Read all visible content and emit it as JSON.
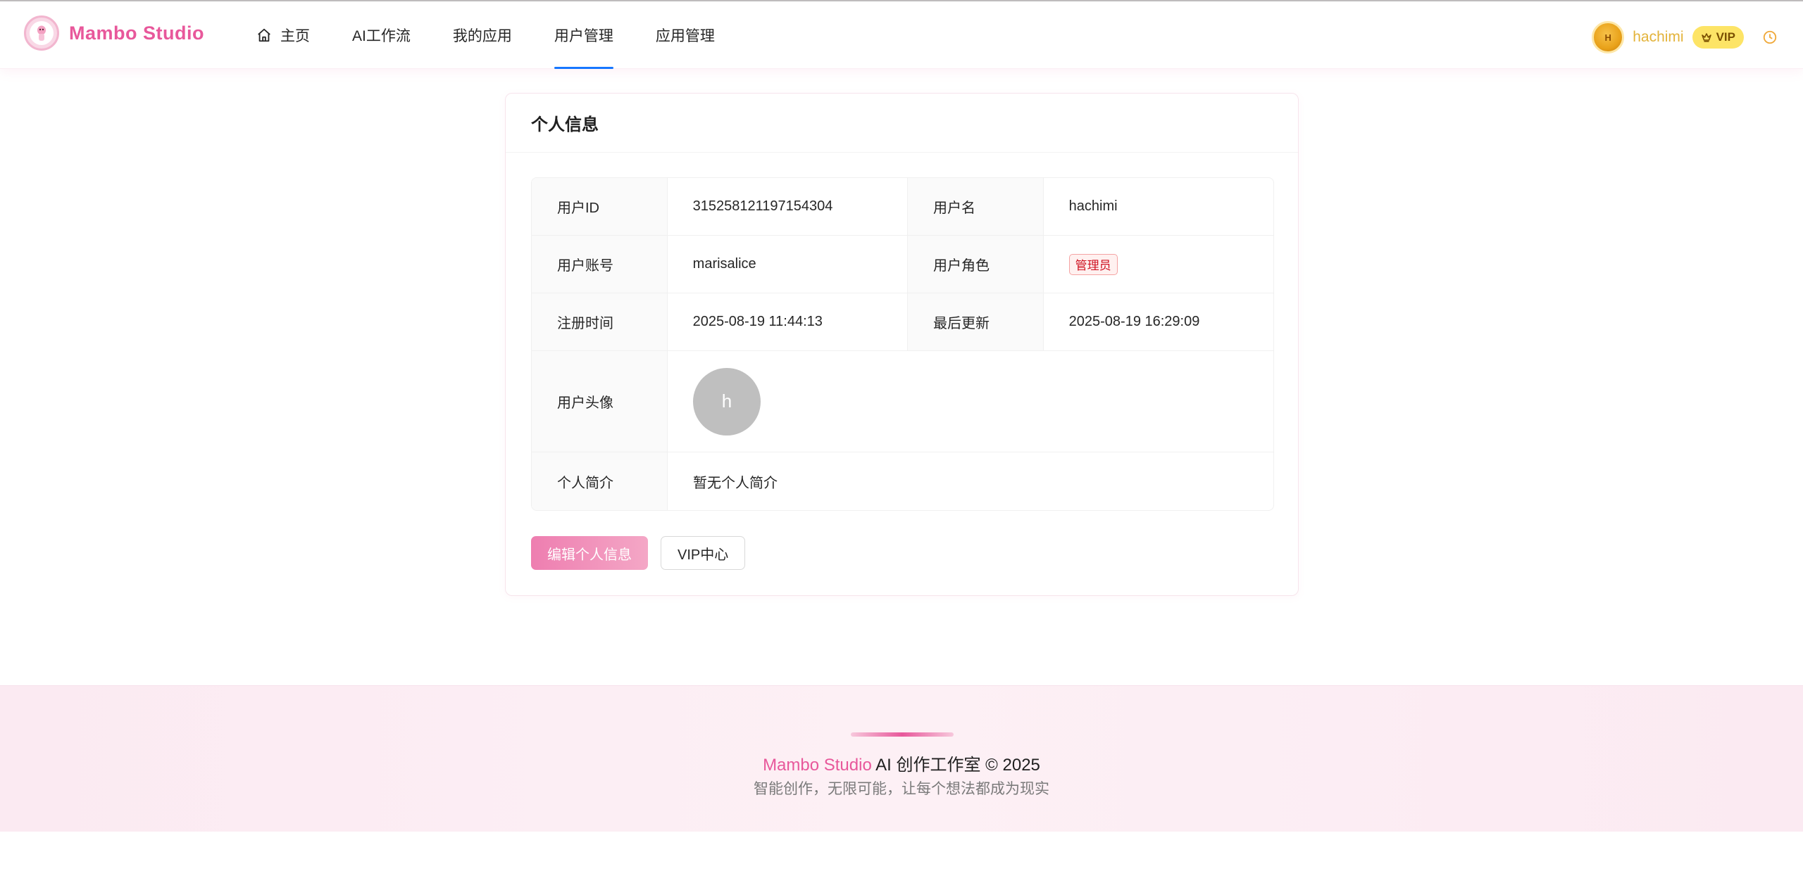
{
  "brand": {
    "name": "Mambo Studio"
  },
  "nav": {
    "items": [
      {
        "label": "主页",
        "icon": "home-icon"
      },
      {
        "label": "AI工作流"
      },
      {
        "label": "我的应用"
      },
      {
        "label": "用户管理",
        "active": true
      },
      {
        "label": "应用管理"
      }
    ]
  },
  "user": {
    "avatar_initial": "H",
    "name": "hachimi",
    "vip_label": "VIP"
  },
  "profile": {
    "title": "个人信息",
    "fields": {
      "user_id_label": "用户ID",
      "user_id": "315258121197154304",
      "username_label": "用户名",
      "username": "hachimi",
      "account_label": "用户账号",
      "account": "marisalice",
      "role_label": "用户角色",
      "role": "管理员",
      "register_label": "注册时间",
      "register_time": "2025-08-19 11:44:13",
      "updated_label": "最后更新",
      "updated_time": "2025-08-19 16:29:09",
      "avatar_label": "用户头像",
      "avatar_initial": "h",
      "bio_label": "个人简介",
      "bio": "暂无个人简介"
    },
    "buttons": {
      "edit": "编辑个人信息",
      "vip": "VIP中心"
    }
  },
  "footer": {
    "brand": "Mambo Studio",
    "main_suffix": " AI 创作工作室 © 2025",
    "tagline": "智能创作，无限可能，让每个想法都成为现实"
  },
  "colors": {
    "brand_pink": "#e8589b",
    "nav_active": "#1677ff",
    "vip_yellow": "#fde466",
    "username_gold": "#e3b33a",
    "role_red": "#cf1322"
  }
}
